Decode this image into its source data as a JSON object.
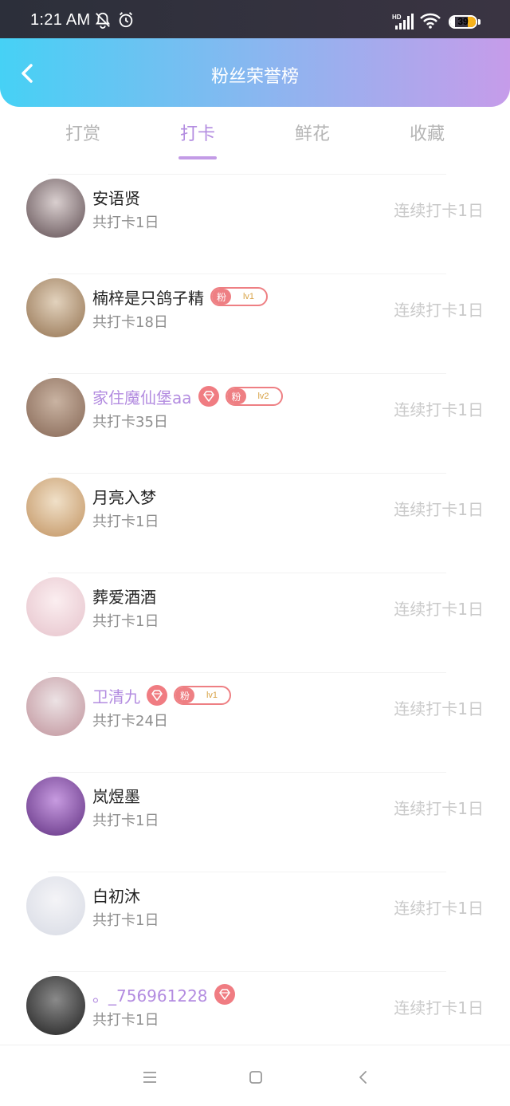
{
  "status_bar": {
    "time": "1:21 AM",
    "battery_level": "39",
    "icons": [
      "bell-off-icon",
      "alarm-icon",
      "hd-signal-icon",
      "wifi-icon",
      "battery-icon"
    ]
  },
  "header": {
    "title": "粉丝荣誉榜",
    "back_icon": "chevron-left-icon",
    "gradient": [
      "#46d1f5",
      "#c69cea"
    ]
  },
  "tabs": [
    {
      "label": "打赏",
      "active": false
    },
    {
      "label": "打卡",
      "active": true
    },
    {
      "label": "鲜花",
      "active": false
    },
    {
      "label": "收藏",
      "active": false
    }
  ],
  "accent_color": "#b38ce0",
  "fan_badge_label": "粉",
  "fans": [
    {
      "name": "安语贤",
      "count_text": "共打卡1日",
      "streak_text": "连续打卡1日",
      "vip": false,
      "fan_level": null
    },
    {
      "name": "楠梓是只鸽子精",
      "count_text": "共打卡18日",
      "streak_text": "连续打卡1日",
      "vip": false,
      "fan_level": "lv1"
    },
    {
      "name": "家住魔仙堡aa",
      "count_text": "共打卡35日",
      "streak_text": "连续打卡1日",
      "vip": true,
      "fan_level": "lv2"
    },
    {
      "name": "月亮入梦",
      "count_text": "共打卡1日",
      "streak_text": "连续打卡1日",
      "vip": false,
      "fan_level": null
    },
    {
      "name": "葬爱酒酒",
      "count_text": "共打卡1日",
      "streak_text": "连续打卡1日",
      "vip": false,
      "fan_level": null
    },
    {
      "name": "卫清九",
      "count_text": "共打卡24日",
      "streak_text": "连续打卡1日",
      "vip": true,
      "fan_level": "lv1"
    },
    {
      "name": "岚煜墨",
      "count_text": "共打卡1日",
      "streak_text": "连续打卡1日",
      "vip": false,
      "fan_level": null
    },
    {
      "name": "白初沐",
      "count_text": "共打卡1日",
      "streak_text": "连续打卡1日",
      "vip": false,
      "fan_level": null
    },
    {
      "name": "。_756961228",
      "count_text": "共打卡1日",
      "streak_text": "连续打卡1日",
      "vip": true,
      "fan_level": null
    }
  ],
  "nav_bar": {
    "icons": [
      "menu-icon",
      "home-square-icon",
      "back-triangle-icon"
    ]
  }
}
